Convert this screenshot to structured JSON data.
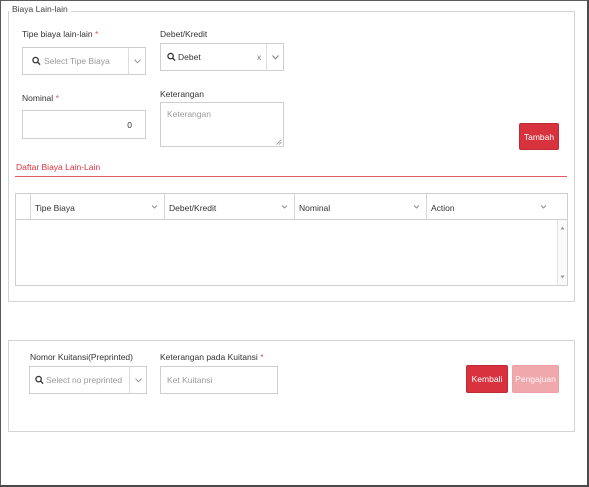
{
  "panel1": {
    "legend": "Biaya Lain-lain",
    "tipe_label": "Tipe biaya lain-lain",
    "tipe_placeholder": "Select Tipe Biaya",
    "debet_label": "Debet/Kredit",
    "debet_value": "Debet",
    "clear_symbol": "x",
    "nominal_label": "Nominal",
    "nominal_value": "0",
    "keterangan_label": "Keterangan",
    "keterangan_placeholder": "Keterangan",
    "tambah_label": "Tambah",
    "required_marker": "*"
  },
  "daftar": {
    "title": "Daftar Biaya Lain-Lain",
    "columns": [
      "Tipe Biaya",
      "Debet/Kredit",
      "Nominal",
      "Action"
    ],
    "rows": []
  },
  "panel2": {
    "nomor_label": "Nomor Kuitansi(Preprinted)",
    "nomor_placeholder": "Select no preprinted",
    "ket_label": "Keterangan pada Kuitansi",
    "ket_placeholder": "Ket Kuitansi",
    "kembali_label": "Kembali",
    "pengajuan_label": "Pengajuan"
  },
  "colors": {
    "accent": "#d7323d",
    "accent_disabled": "#f0a8ad",
    "border": "#cfcfcf"
  },
  "icons": [
    "search-icon",
    "chevron-down-icon",
    "clear-icon",
    "resize-handle-icon",
    "scroll-up-icon",
    "scroll-down-icon"
  ]
}
